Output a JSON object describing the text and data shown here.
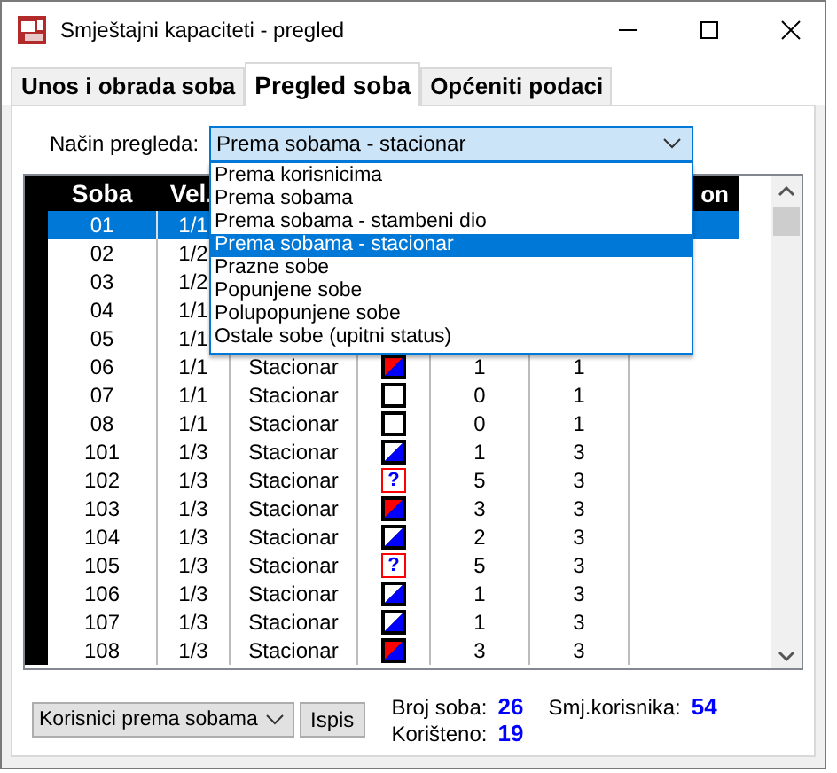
{
  "window": {
    "title": "Smještajni kapaciteti - pregled"
  },
  "tabs": [
    {
      "label": "Unos i obrada soba",
      "selected": false
    },
    {
      "label": "Pregled soba",
      "selected": true
    },
    {
      "label": "Općeniti podaci",
      "selected": false
    }
  ],
  "view_mode": {
    "label": "Način pregleda:",
    "value": "Prema sobama - stacionar",
    "expanded": true,
    "options": [
      {
        "label": "Prema korisnicima",
        "selected": false
      },
      {
        "label": "Prema sobama",
        "selected": false
      },
      {
        "label": "Prema sobama - stambeni dio",
        "selected": false
      },
      {
        "label": "Prema sobama - stacionar",
        "selected": true
      },
      {
        "label": "Prazne sobe",
        "selected": false
      },
      {
        "label": "Popunjene sobe",
        "selected": false
      },
      {
        "label": "Polupopunjene sobe",
        "selected": false
      },
      {
        "label": "Ostale sobe (upitni status)",
        "selected": false
      }
    ]
  },
  "table": {
    "header": {
      "soba": "Soba",
      "vel": "Vel.",
      "column_8": "on"
    },
    "rows": [
      {
        "soba": "01",
        "vel": "1/1",
        "selected": true
      },
      {
        "soba": "02",
        "vel": "1/2",
        "selected": false
      },
      {
        "soba": "03",
        "vel": "1/2",
        "selected": false
      },
      {
        "soba": "04",
        "vel": "1/1",
        "selected": false
      },
      {
        "soba": "05",
        "vel": "1/1",
        "selected": false
      },
      {
        "soba": "06",
        "vel": "1/1",
        "type": "Stacionar",
        "kind": "full",
        "column_6": "1",
        "column_7": "1",
        "selected": false
      },
      {
        "soba": "07",
        "vel": "1/1",
        "type": "Stacionar",
        "kind": "empty",
        "column_6": "0",
        "column_7": "1",
        "selected": false
      },
      {
        "soba": "08",
        "vel": "1/1",
        "type": "Stacionar",
        "kind": "empty",
        "column_6": "0",
        "column_7": "1",
        "selected": false
      },
      {
        "soba": "101",
        "vel": "1/3",
        "type": "Stacionar",
        "kind": "half",
        "column_6": "1",
        "column_7": "3",
        "selected": false
      },
      {
        "soba": "102",
        "vel": "1/3",
        "type": "Stacionar",
        "kind": "unknown",
        "mark": "?",
        "column_6": "5",
        "column_7": "3",
        "selected": false
      },
      {
        "soba": "103",
        "vel": "1/3",
        "type": "Stacionar",
        "kind": "full",
        "column_6": "3",
        "column_7": "3",
        "selected": false
      },
      {
        "soba": "104",
        "vel": "1/3",
        "type": "Stacionar",
        "kind": "half",
        "column_6": "2",
        "column_7": "3",
        "selected": false
      },
      {
        "soba": "105",
        "vel": "1/3",
        "type": "Stacionar",
        "kind": "unknown",
        "mark": "?",
        "column_6": "5",
        "column_7": "3",
        "selected": false
      },
      {
        "soba": "106",
        "vel": "1/3",
        "type": "Stacionar",
        "kind": "half",
        "column_6": "1",
        "column_7": "3",
        "selected": false
      },
      {
        "soba": "107",
        "vel": "1/3",
        "type": "Stacionar",
        "kind": "half",
        "column_6": "1",
        "column_7": "3",
        "selected": false
      },
      {
        "soba": "108",
        "vel": "1/3",
        "type": "Stacionar",
        "kind": "full",
        "column_6": "3",
        "column_7": "3",
        "selected": false
      }
    ]
  },
  "footer": {
    "report_select": "Korisnici prema sobama",
    "print_button": "Ispis",
    "stats": [
      {
        "label": "Broj soba:",
        "value": "26"
      },
      {
        "label": "Smj.korisnika:",
        "value": "54"
      },
      {
        "label": "Korišteno:",
        "value": "19"
      }
    ]
  }
}
